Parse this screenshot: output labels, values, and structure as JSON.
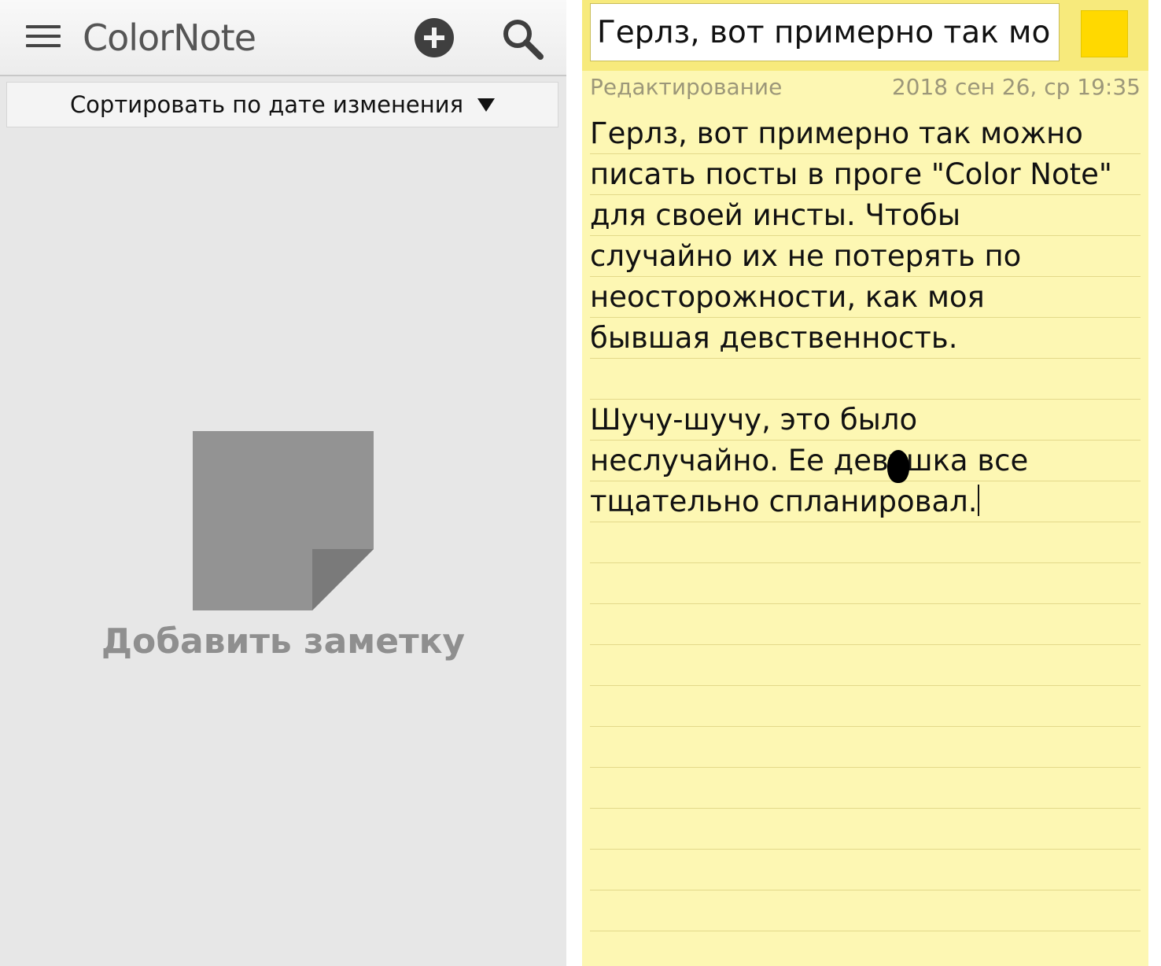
{
  "list_screen": {
    "app_title": "ColorNote",
    "menu_icon": "hamburger-menu-icon",
    "add_icon": "plus-circle-icon",
    "search_icon": "search-icon",
    "sort_label": "Сортировать по дате изменения",
    "sort_caret": "triangle-down-icon",
    "empty_note_icon": "sticky-note-icon",
    "empty_label": "Добавить заметку"
  },
  "editor_screen": {
    "title_value": "Герлз, вот примерно так мо",
    "color_swatch": "#ffd900",
    "mode_label": "Редактирование",
    "modified": "2018 сен 26, ср 19:35",
    "body_lines": [
      "Герлз, вот примерно так можно",
      "писать посты в проге \"Color Note\"",
      "для своей инсты. Чтобы",
      "случайно их не потерять по",
      "неосторожности, как моя",
      "бывшая девственность.",
      "",
      "Шучу-шучу, это было",
      "неслучайно. Ее девушка все",
      "тщательно спланировал."
    ]
  },
  "colors": {
    "list_background": "#e7e7e7",
    "note_background": "#fdf7b3",
    "note_header": "#f7ea7c"
  }
}
